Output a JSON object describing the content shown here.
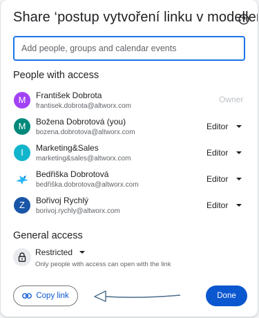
{
  "dialog": {
    "title": "Share ‘postup vytvoření linku v modelleru’",
    "help_icon": "help-circle-icon"
  },
  "add_people": {
    "placeholder": "Add people, groups and calendar events",
    "value": ""
  },
  "people_section": {
    "heading": "People with access",
    "people": [
      {
        "name": "František Dobrota",
        "email": "frantisek.dobrota@altworx.com",
        "avatar_letter": "M",
        "avatar_color": "#a142f4",
        "role": "Owner",
        "editable": false
      },
      {
        "name": "Božena Dobrotová (you)",
        "email": "bozena.dobrotova@altworx.com",
        "avatar_letter": "M",
        "avatar_color": "#00897b",
        "role": "Editor",
        "editable": true
      },
      {
        "name": "Marketing&Sales",
        "email": "marketing&sales@altworx.com",
        "avatar_letter": "I",
        "avatar_color": "#12b5cb",
        "role": "Editor",
        "editable": true
      },
      {
        "name": "Bedřiška Dobrotová",
        "email": "bedřiška.dobrotova@altworx.com",
        "avatar_letter": "",
        "avatar_color": "#4fc3f7",
        "avatar_icon": "bird-photo-icon",
        "role": "Editor",
        "editable": true
      },
      {
        "name": "Bořivoj Rychlý",
        "email": "borivoj.rychly@altworx.com",
        "avatar_letter": "Z",
        "avatar_color": "#1a56a8",
        "role": "Editor",
        "editable": true
      }
    ]
  },
  "general_access": {
    "heading": "General access",
    "icon": "lock-icon",
    "level": "Restricted",
    "description": "Only people with access can open with the link"
  },
  "footer": {
    "copy_link_label": "Copy link",
    "copy_link_icon": "link-icon",
    "done_label": "Done"
  },
  "colors": {
    "accent": "#0b57d0",
    "input_border": "#1a73e8"
  }
}
